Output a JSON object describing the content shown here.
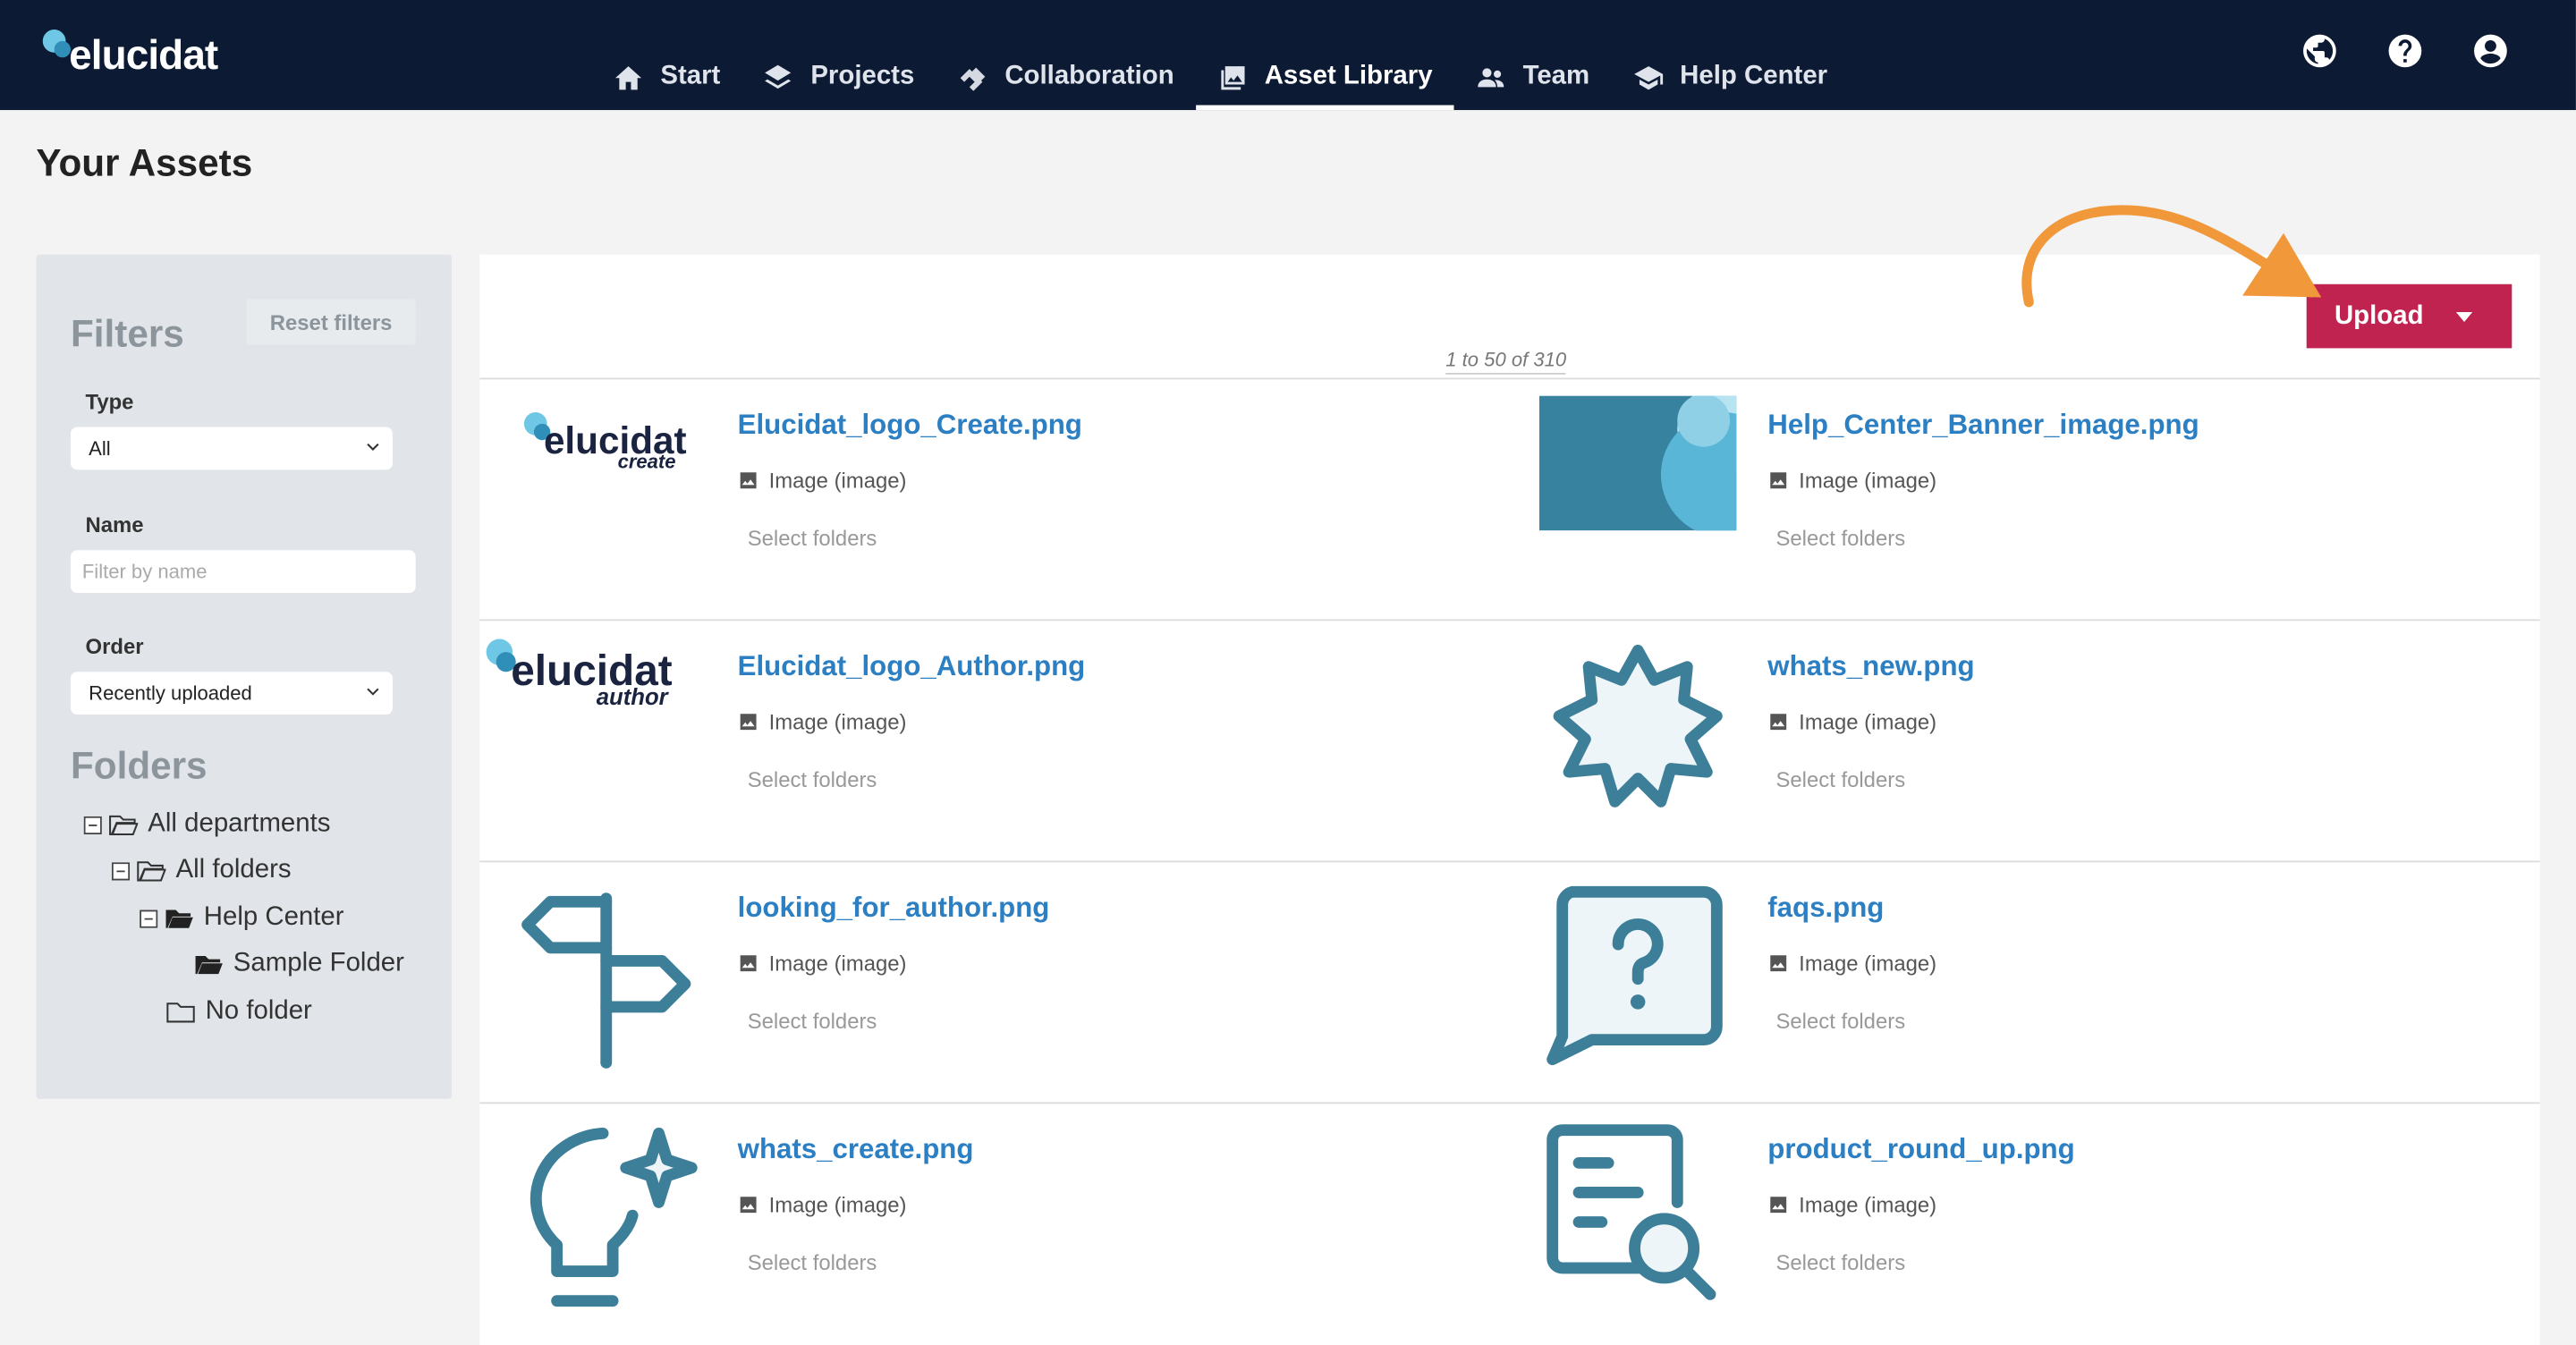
{
  "brand": {
    "name": "elucidat"
  },
  "nav": [
    {
      "label": "Start",
      "icon": "home-icon"
    },
    {
      "label": "Projects",
      "icon": "layers-icon"
    },
    {
      "label": "Collaboration",
      "icon": "collaboration-icon"
    },
    {
      "label": "Asset Library",
      "icon": "image-library-icon",
      "active": true
    },
    {
      "label": "Team",
      "icon": "team-icon"
    },
    {
      "label": "Help Center",
      "icon": "graduation-cap-icon"
    }
  ],
  "top_icons": [
    "globe-icon",
    "help-icon",
    "account-icon"
  ],
  "page": {
    "title": "Your Assets"
  },
  "filters": {
    "heading": "Filters",
    "reset_label": "Reset filters",
    "type_label": "Type",
    "type_value": "All",
    "name_label": "Name",
    "name_placeholder": "Filter by name",
    "order_label": "Order",
    "order_value": "Recently uploaded"
  },
  "folders": {
    "heading": "Folders",
    "tree": [
      {
        "label": "All departments",
        "level": 0,
        "toggle": true,
        "open": true
      },
      {
        "label": "All folders",
        "level": 1,
        "toggle": true,
        "open": true
      },
      {
        "label": "Help Center",
        "level": 2,
        "toggle": true,
        "open": true,
        "filled": true
      },
      {
        "label": "Sample Folder",
        "level": 3,
        "toggle": false,
        "open": true,
        "filled": true
      },
      {
        "label": "No folder",
        "level": 2,
        "toggle": false,
        "open": false
      }
    ]
  },
  "assets": {
    "count_text": "1 to 50 of 310",
    "upload_label": "Upload",
    "type_text": "Image (image)",
    "folders_text": "Select folders",
    "items": [
      {
        "name": "Elucidat_logo_Create.png",
        "thumb": "elucidat-create-logo",
        "logo_word": "elucidat",
        "logo_sub": "create"
      },
      {
        "name": "Help_Center_Banner_image.png",
        "thumb": "banner-image"
      },
      {
        "name": "Elucidat_logo_Author.png",
        "thumb": "elucidat-author-logo",
        "logo_word": "elucidat",
        "logo_sub": "author"
      },
      {
        "name": "whats_new.png",
        "thumb": "badge-icon"
      },
      {
        "name": "looking_for_author.png",
        "thumb": "signpost-icon"
      },
      {
        "name": "faqs.png",
        "thumb": "question-bubble-icon"
      },
      {
        "name": "whats_create.png",
        "thumb": "lightbulb-sparkle-icon"
      },
      {
        "name": "product_round_up.png",
        "thumb": "document-search-icon"
      }
    ]
  },
  "colors": {
    "nav_bg": "#0d1a33",
    "upload_bg": "#c0234f",
    "link": "#2b7fc2",
    "icon_teal": "#3d7f99",
    "arrow": "#f0983a"
  }
}
